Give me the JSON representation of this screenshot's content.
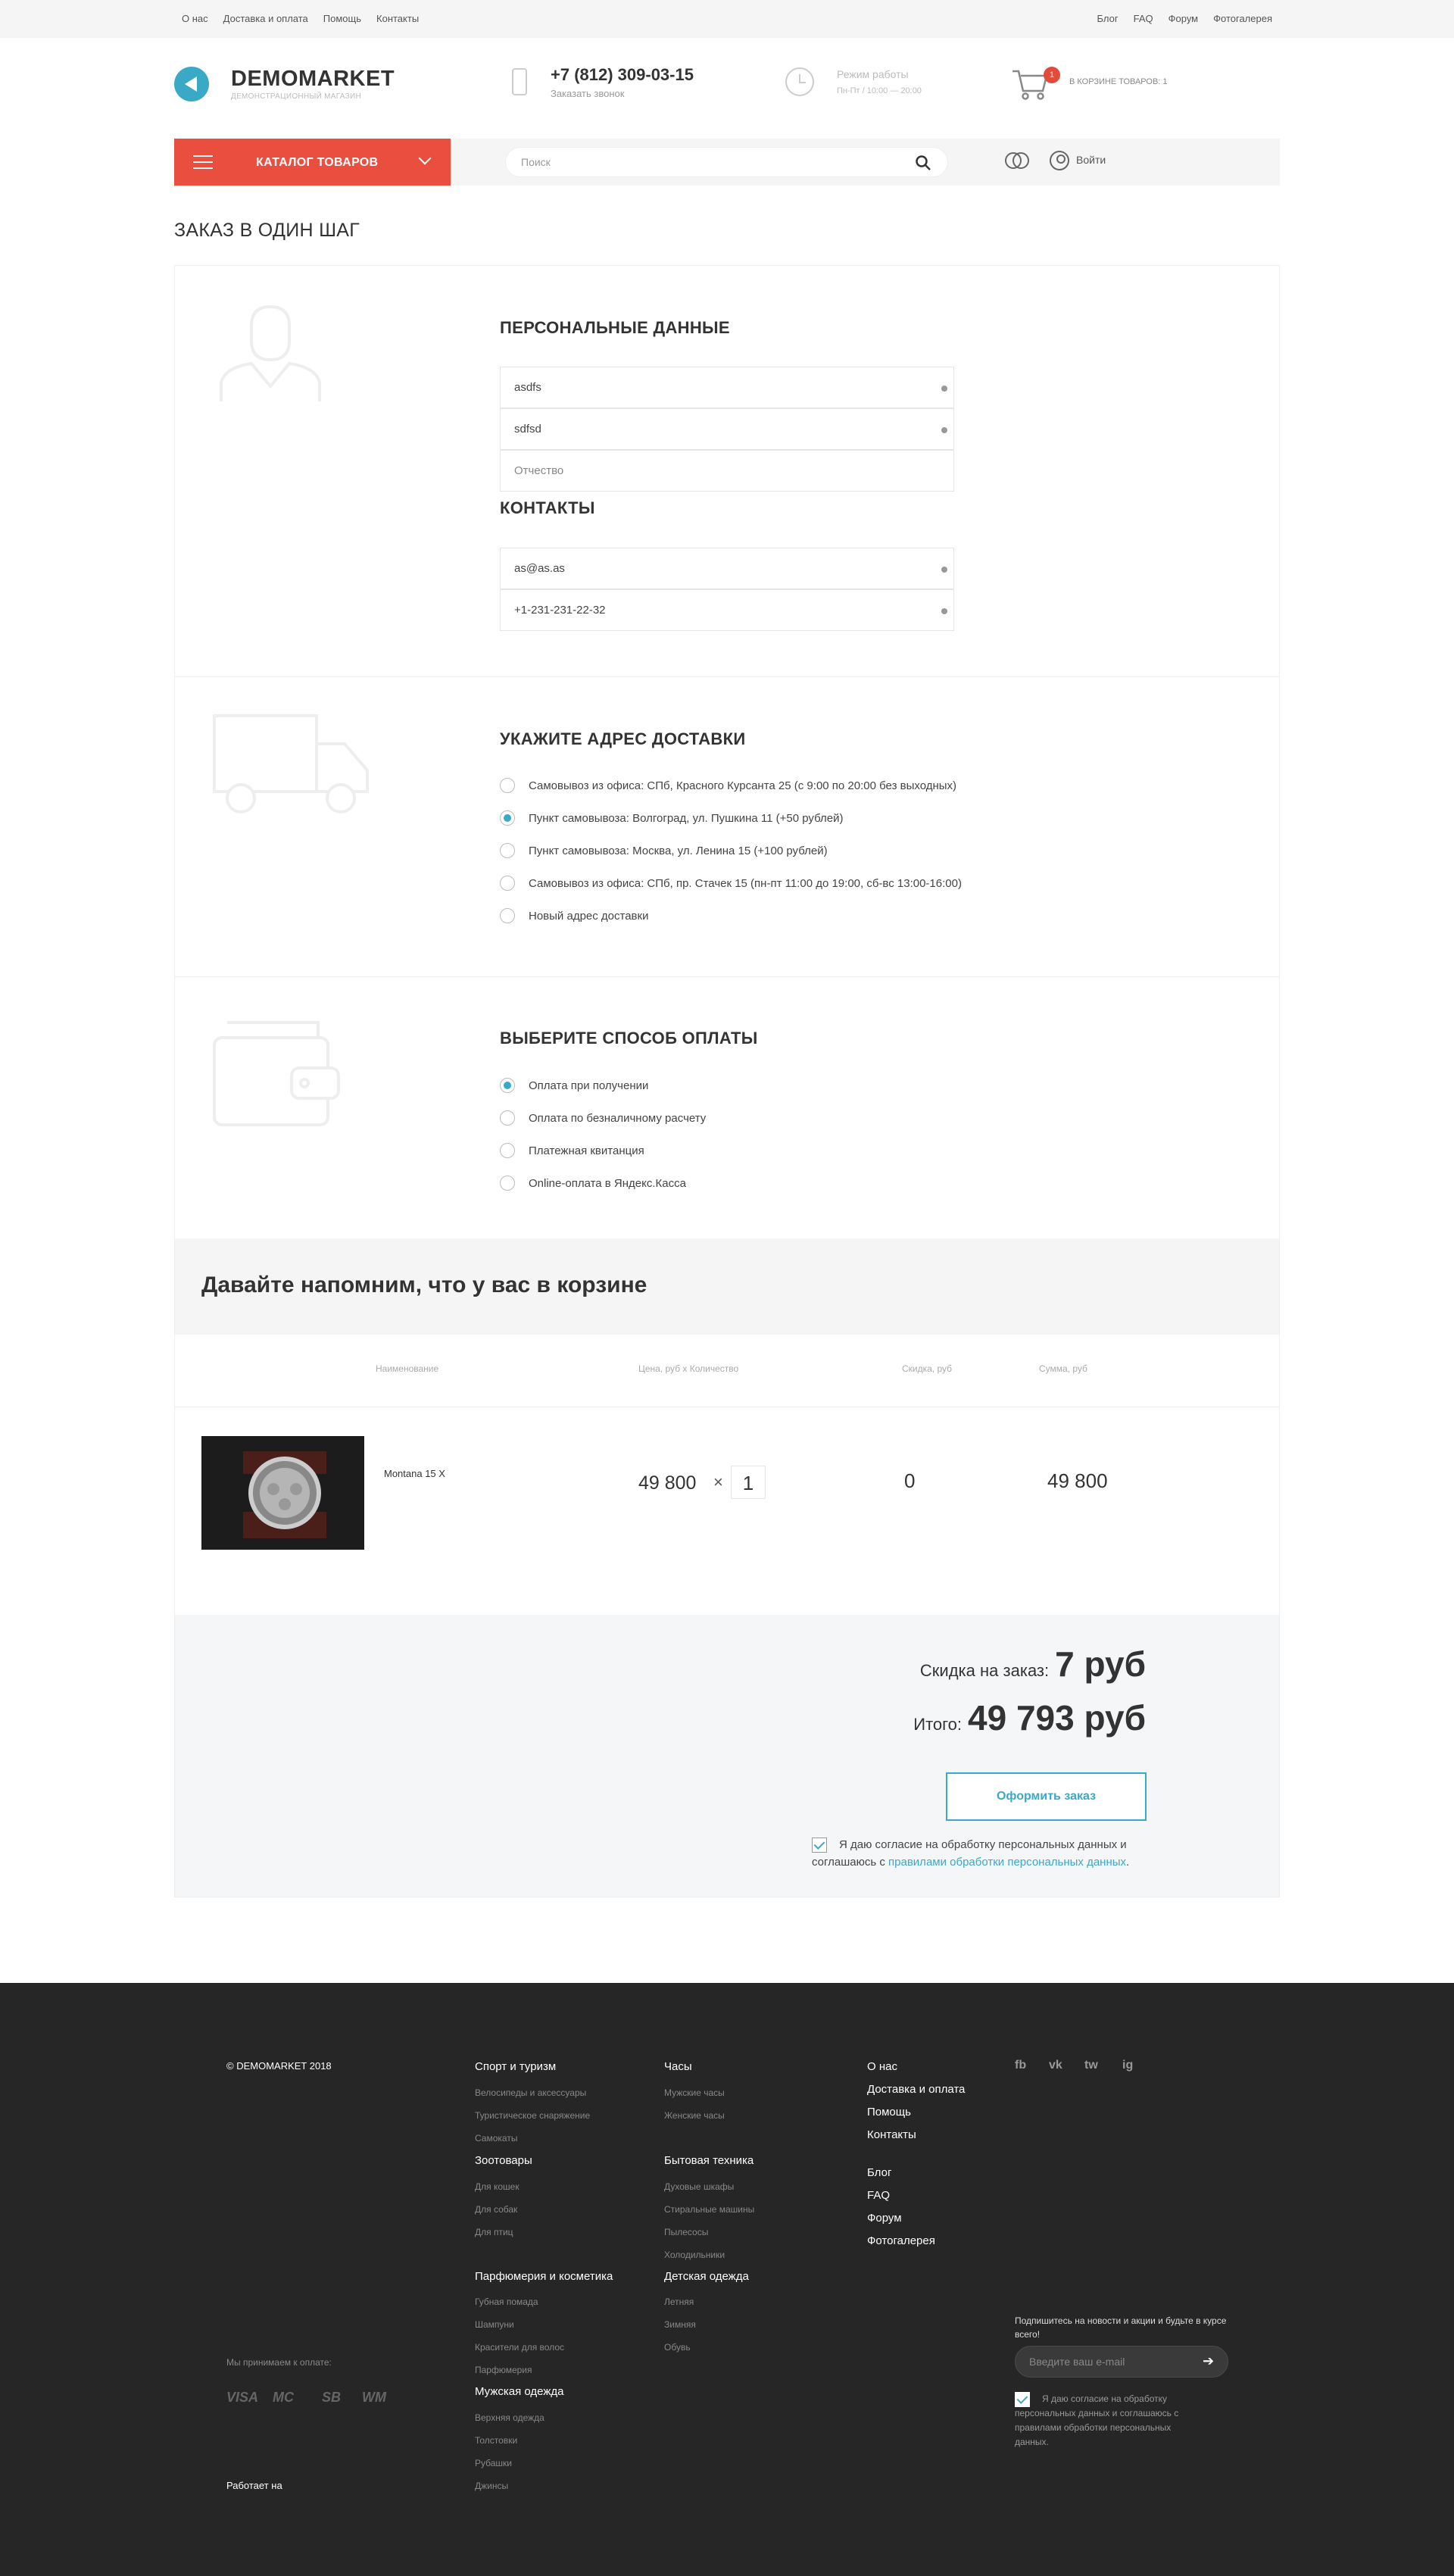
{
  "topbar": {
    "left_links": [
      "О нас",
      "Доставка и оплата",
      "Помощь",
      "Контакты"
    ],
    "right_links": [
      "Блог",
      "FAQ",
      "Форум",
      "Фотогалерея"
    ]
  },
  "header": {
    "logo_title": "DEMOMARKET",
    "logo_sub": "ДЕМОНСТРАЦИОННЫЙ МАГАЗИН",
    "phone": "+7 (812) 309-03-15",
    "phone_sub": "Заказать звонок",
    "hours_title": "Режим работы",
    "hours_sub": "Пн-Пт / 10:00 — 20:00",
    "cart_count": "1",
    "cart_label": "В КОРЗИНЕ ТОВАРОВ: 1"
  },
  "nav": {
    "catalog_label": "КАТАЛОГ ТОВАРОВ",
    "search_placeholder": "Поиск",
    "login_label": "Войти"
  },
  "page_title": "ЗАКАЗ В ОДИН ШАГ",
  "personal": {
    "title": "ПЕРСОНАЛЬНЫЕ ДАННЫЕ",
    "first_name": "asdfs",
    "last_name": "sdfsd",
    "middle_name_placeholder": "Отчество"
  },
  "contacts": {
    "title": "КОНТАКТЫ",
    "email": "as@as.as",
    "phone": "+1-231-231-22-32"
  },
  "delivery": {
    "title": "УКАЖИТЕ АДРЕС ДОСТАВКИ",
    "options": [
      {
        "label": "Самовывоз из офиса: СПб, Красного Курсанта 25 (с 9:00 по 20:00 без выходных)",
        "checked": false
      },
      {
        "label": "Пункт самовывоза: Волгоград, ул. Пушкина 11 (+50 рублей)",
        "checked": true
      },
      {
        "label": "Пункт самовывоза: Москва, ул. Ленина 15 (+100 рублей)",
        "checked": false
      },
      {
        "label": "Самовывоз из офиса: СПб, пр. Стачек 15 (пн-пт 11:00 до 19:00, сб-вс 13:00-16:00)",
        "checked": false
      },
      {
        "label": "Новый адрес доставки",
        "checked": false
      }
    ]
  },
  "payment": {
    "title": "ВЫБЕРИТЕ СПОСОБ ОПЛАТЫ",
    "options": [
      {
        "label": "Оплата при получении",
        "checked": true
      },
      {
        "label": "Оплата по безналичному расчету",
        "checked": false
      },
      {
        "label": "Платежная квитанция",
        "checked": false
      },
      {
        "label": "Online-оплата в Яндекс.Касса",
        "checked": false
      }
    ]
  },
  "cart": {
    "title": "Давайте напомним, что у вас в корзине",
    "columns": [
      "Наименование",
      "Цена, руб х Количество",
      "Скидка, руб",
      "Сумма, руб"
    ],
    "item": {
      "name": "Montana 15 X",
      "price": "49 800",
      "times": "×",
      "qty": "1",
      "discount": "0",
      "sum": "49 800"
    }
  },
  "summary": {
    "discount_label": "Скидка на заказ:",
    "discount_value": "7 руб",
    "total_label": "Итого:",
    "total_value": "49 793 руб",
    "order_button": "Оформить заказ",
    "consent_text": "Я даю согласие на обработку персональных данных и соглашаюсь с ",
    "consent_link": "правилами обработки персональных данных",
    "consent_end": "."
  },
  "footer": {
    "copyright": "© DEMOMARKET 2018",
    "col1": [
      {
        "title": "Спорт и туризм",
        "links": [
          "Велосипеды и аксессуары",
          "Туристическое снаряжение",
          "Самокаты"
        ]
      },
      {
        "title": "Зоотовары",
        "links": [
          "Для кошек",
          "Для собак",
          "Для птиц"
        ]
      },
      {
        "title": "Парфюмерия и косметика",
        "links": [
          "Губная помада",
          "Шампуни",
          "Красители для волос",
          "Парфюмерия"
        ]
      },
      {
        "title": "Мужская одежда",
        "links": [
          "Верхняя одежда",
          "Толстовки",
          "Рубашки",
          "Джинсы"
        ]
      }
    ],
    "col2": [
      {
        "title": "Часы",
        "links": [
          "Мужские часы",
          "Женские часы"
        ]
      },
      {
        "title": "Бытовая техника",
        "links": [
          "Духовые шкафы",
          "Стиральные машины",
          "Пылесосы",
          "Холодильники"
        ]
      },
      {
        "title": "Детская одежда",
        "links": [
          "Летняя",
          "Зимняя",
          "Обувь"
        ]
      }
    ],
    "info_links": [
      "О нас",
      "Доставка и оплата",
      "Помощь",
      "Контакты"
    ],
    "community_links": [
      "Блог",
      "FAQ",
      "Форум",
      "Фотогалерея"
    ],
    "social": [
      "fb",
      "vk",
      "tw",
      "ig"
    ],
    "pay_label": "Мы принимаем к оплате:",
    "pay_methods": [
      "VISA",
      "MC",
      "SB",
      "WM"
    ],
    "works_on": "Работает на",
    "subscribe_text": "Подпишитесь на новости и акции и будьте в курсе всего!",
    "email_placeholder": "Введите ваш e-mail",
    "consent": "Я даю согласие на обработку персональных данных и соглашаюсь с правилами обработки персональных данных."
  }
}
